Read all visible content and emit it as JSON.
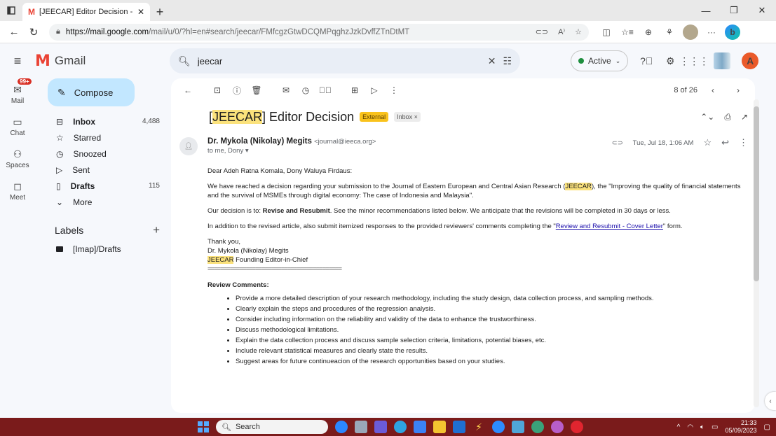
{
  "browser": {
    "tab_title": "[JEECAR] Editor Decision - adeh",
    "url_host": "https://mail.google.com",
    "url_path": "/mail/u/0/?hl=en#search/jeecar/FMfcgzGtwDCQMPqghzJzkDvffZTnDtMT"
  },
  "header": {
    "app_name": "Gmail",
    "search_value": "jeecar",
    "status": "Active",
    "avatar_letter": "A"
  },
  "rail": {
    "mail_badge": "99+",
    "items": [
      {
        "label": "Mail"
      },
      {
        "label": "Chat"
      },
      {
        "label": "Spaces"
      },
      {
        "label": "Meet"
      }
    ]
  },
  "sidebar": {
    "compose": "Compose",
    "items": [
      {
        "label": "Inbox",
        "count": "4,488",
        "icon": "inbox-icon"
      },
      {
        "label": "Starred",
        "count": "",
        "icon": "star-icon"
      },
      {
        "label": "Snoozed",
        "count": "",
        "icon": "clock-icon"
      },
      {
        "label": "Sent",
        "count": "",
        "icon": "send-icon"
      },
      {
        "label": "Drafts",
        "count": "115",
        "icon": "draft-icon"
      },
      {
        "label": "More",
        "count": "",
        "icon": "chevron-down-icon"
      }
    ],
    "labels_title": "Labels",
    "labels": [
      {
        "label": "[Imap]/Drafts"
      }
    ]
  },
  "toolbar": {
    "pager": "8 of 26"
  },
  "email": {
    "subject_tag": "JEECAR",
    "subject_rest": " Editor Decision",
    "external_tag": "External",
    "inbox_tag": "Inbox ×",
    "sender_name": "Dr. Mykola (Nikolay) Megits",
    "sender_email": "<journal@ieeca.org>",
    "to_line": "to me, Dony",
    "date": "Tue, Jul 18, 1:06 AM",
    "greeting": "Dear Adeh Ratna Komala, Dony Waluya Firdaus:",
    "para1_a": "We have reached a decision regarding your submission to the Journal of Eastern European and Central Asian Research (",
    "para1_hl": "JEECAR",
    "para1_b": "), the \"Improving the quality of financial statements and the survival of MSMEs through digital economy: The case of Indonesia and Malaysia\".",
    "para2_a": "Our decision is to: ",
    "para2_bold": "Revise and Resubmit",
    "para2_b": ". See the minor recommendations listed below. We anticipate that the revisions will be completed in 30 days or less.",
    "para3_a": "In addition to the revised article, also submit itemized responses to the provided reviewers' comments completing the \"",
    "para3_link": "Review and Resubmit - Cover Letter",
    "para3_b": "\" form.",
    "sig_thanks": "Thank you,",
    "sig_name": "Dr. Mykola (Nikolay) Megits",
    "sig_role_hl": "JEECAR",
    "sig_role": " Founding Editor-in-Chief",
    "rule": "==========================================",
    "review_title": "Review Comments:",
    "review_items": [
      "Provide a more detailed description of your research methodology, including the study design, data collection process, and sampling methods.",
      "Clearly explain the steps and procedures of the regression analysis.",
      "Consider including information on the reliability and validity of the data to enhance the trustworthiness.",
      "Discuss methodological limitations.",
      "Explain the data collection process and discuss sample selection criteria, limitations, potential biases, etc.",
      "Include relevant statistical measures and clearly state the results.",
      "Suggest areas for future continueacion of the research opportunities based on your studies."
    ]
  },
  "taskbar": {
    "search": "Search",
    "time": "21:33",
    "date": "05/09/2023"
  },
  "colors": {
    "compose_bg": "#c2e7ff",
    "highlight": "#fbe27c",
    "external_tag": "#f9c21c",
    "taskbar": "#7a1b1b"
  }
}
